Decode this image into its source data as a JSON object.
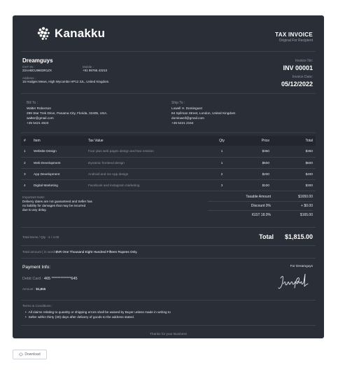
{
  "brand": {
    "name": "Kanakku"
  },
  "header": {
    "title": "TAX INVOICE",
    "subtitle": "Original For Recipient"
  },
  "company": {
    "name": "Dreamguys",
    "gst_label": "GST IN :",
    "gst_value": "22AABCU9603R1ZX",
    "mobile_label": "Mobile :",
    "mobile_value": "+91 98765 43210",
    "address_label": "Address :",
    "address_value": "15 Hodges Mews, High Wycombe HP12 3JL, United Kingdom."
  },
  "invoice": {
    "no_label": "Invoice No:",
    "no_value": "INV 00001",
    "date_label": "Invoice Date:",
    "date_value": "05/12/2022"
  },
  "bill_to": {
    "label": "Bill To :",
    "name": "Walter Roberson",
    "address": "299 Star Trek Drive, Panama City, Florida, 32405, USA.",
    "email": "walter@gmail.com",
    "phone": "+45 5421 4523"
  },
  "ship_to": {
    "label": "Ship To :",
    "name": "Lowell H. Dominguez",
    "address": "84 Spilman Street, London, United Kingdom",
    "email": "domlowell@gmail.com",
    "phone": "+45 5421 2154"
  },
  "table": {
    "headers": {
      "num": "#",
      "item": "Item",
      "tax": "Tax Value",
      "qty": "Qty",
      "price": "Price",
      "total": "Total"
    },
    "rows": [
      {
        "num": "1",
        "item": "Website Design",
        "desc": "Four plus web pages design and two revision",
        "qty": "1",
        "price": "$350",
        "total": "$350"
      },
      {
        "num": "2",
        "item": "Web Development",
        "desc": "Dynamic frontend design",
        "qty": "1",
        "price": "$600",
        "total": "$600"
      },
      {
        "num": "3",
        "item": "App Development",
        "desc": "Android and Ios App design",
        "qty": "2",
        "price": "$200",
        "total": "$400"
      },
      {
        "num": "4",
        "item": "Digital Marketing",
        "desc": "Facebook and instagram marketing",
        "qty": "3",
        "price": "$100",
        "total": "$300"
      }
    ]
  },
  "note": {
    "label": "Important Note:",
    "line1": "Delivery dates are not guaranteed and Seller has",
    "line2": "no liability for damages that may be incurred",
    "line3": "due to any delay."
  },
  "totals": {
    "taxable_label": "Taxable Amount",
    "taxable_value": "$1650.00",
    "discount_label": "Discount 0%",
    "discount_value": "+ $0.00",
    "igst_label": "IGST 18.0%",
    "igst_value": "$165.00",
    "items_qty": "Total Items / Qty : 4 / 4.00",
    "total_label": "Total",
    "total_value": "$1,815.00"
  },
  "words": {
    "label": "Total amount ( in words):",
    "value": "INR One Thousand Eight Hundred Fifteen Rupees Only."
  },
  "payment": {
    "title": "Payment Info:",
    "card_label": "Debit Card :",
    "card_value": "465 *************645",
    "amount_label": "Amount :",
    "amount_value": "$1,815",
    "for_company": "For Dreamguys",
    "signature": "James Paul"
  },
  "terms": {
    "label": "Terms & Conditions :",
    "items": [
      "All claims relating to quantity or shipping errors shall be waived by Buyer unless made in writing to",
      "Seller within thirty (30) days after delivery of goods to the address stated."
    ]
  },
  "footer": {
    "thanks": "Thanks for your Business"
  },
  "download": {
    "label": "Download",
    "icon": "cloud-download-icon"
  },
  "colors": {
    "card_bg": "#2a2e37",
    "header_row": "#23262e",
    "muted": "#8f96a3",
    "page_bg": "#ffffff"
  }
}
